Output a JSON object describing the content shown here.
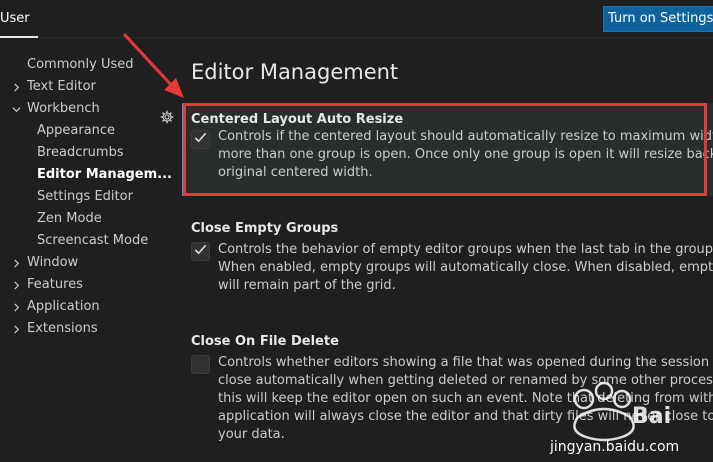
{
  "header": {
    "tab_user": "User",
    "sync_button": "Turn on Settings Sync"
  },
  "sidebar": {
    "items": [
      {
        "label": "Commonly Used",
        "chevron": "none"
      },
      {
        "label": "Text Editor",
        "chevron": "right"
      },
      {
        "label": "Workbench",
        "chevron": "down"
      },
      {
        "label": "Appearance",
        "chevron": "none"
      },
      {
        "label": "Breadcrumbs",
        "chevron": "none"
      },
      {
        "label": "Editor Managem...",
        "chevron": "none",
        "active": true
      },
      {
        "label": "Settings Editor",
        "chevron": "none"
      },
      {
        "label": "Zen Mode",
        "chevron": "none"
      },
      {
        "label": "Screencast Mode",
        "chevron": "none"
      },
      {
        "label": "Window",
        "chevron": "right"
      },
      {
        "label": "Features",
        "chevron": "right"
      },
      {
        "label": "Application",
        "chevron": "right"
      },
      {
        "label": "Extensions",
        "chevron": "right"
      }
    ]
  },
  "main": {
    "section_title": "Editor Management",
    "settings": [
      {
        "title": "Centered Layout Auto Resize",
        "checked": true,
        "lines": [
          "Controls if the centered layout should automatically resize to maximum width when",
          "more than one group is open. Once only one group is open it will resize back to the",
          "original centered width."
        ]
      },
      {
        "title": "Close Empty Groups",
        "checked": true,
        "lines": [
          "Controls the behavior of empty editor groups when the last tab in the group is closed.",
          "When enabled, empty groups will automatically close. When disabled, empty groups",
          "will remain part of the grid."
        ]
      },
      {
        "title": "Close On File Delete",
        "checked": false,
        "lines": [
          "Controls whether editors showing a file that was opened during the session should",
          "close automatically when getting deleted or renamed by some other process. Disabling",
          "this will keep the editor open on such an event. Note that deleting from within the",
          "application will always close the editor and that dirty files will never close to preserve",
          "your data."
        ]
      }
    ]
  },
  "watermark": {
    "text": "jingyan.baidu.com"
  },
  "colors": {
    "accent": "#0e639c",
    "highlight_box": "#e53935",
    "focus_bar": "#3794ff"
  }
}
